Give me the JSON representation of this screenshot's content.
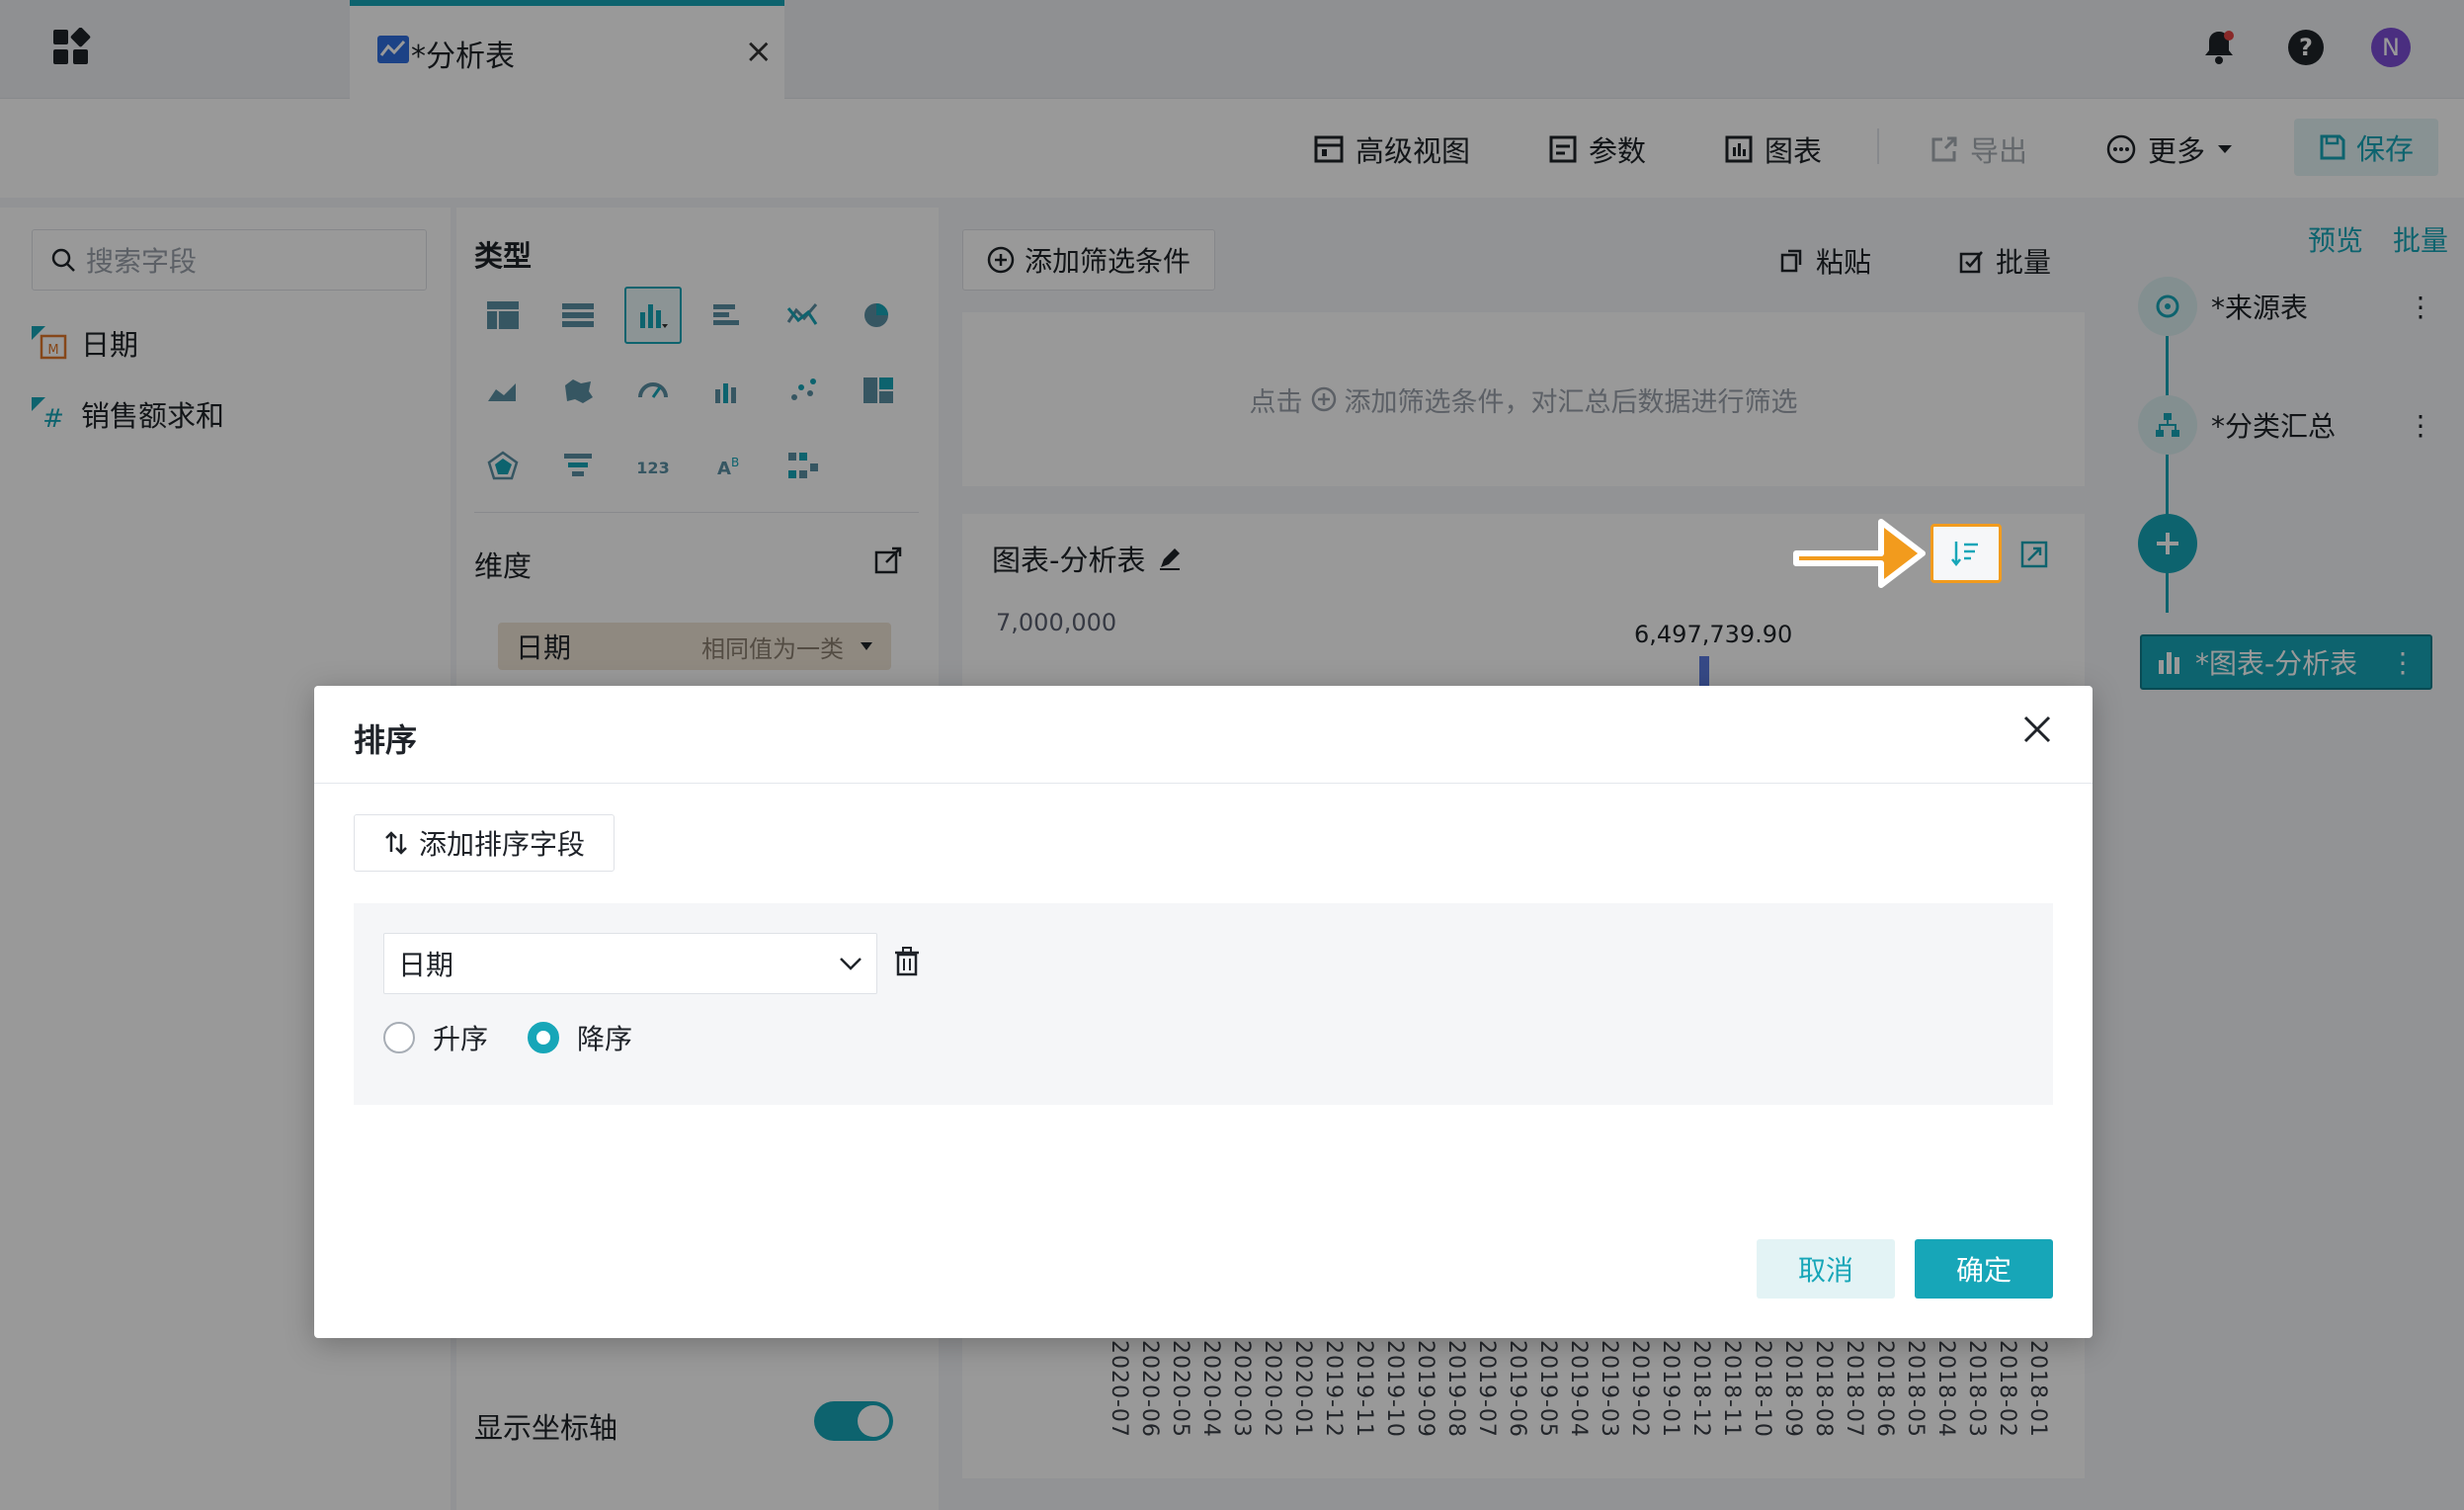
{
  "tab": {
    "title": "*分析表",
    "close": "×"
  },
  "header": {
    "avatar": "N"
  },
  "toolbar": {
    "advanced_view": "高级视图",
    "params": "参数",
    "chart": "图表",
    "export": "导出",
    "more": "更多",
    "save": "保存"
  },
  "fields": {
    "search_placeholder": "搜索字段",
    "items": [
      {
        "label": "日期",
        "type": "date"
      },
      {
        "label": "销售额求和",
        "type": "number"
      }
    ]
  },
  "config": {
    "type_title": "类型",
    "dimension_title": "维度",
    "dimension_chip": {
      "label": "日期",
      "mode": "相同值为一类"
    },
    "show_axis": "显示坐标轴"
  },
  "filter": {
    "add_button": "添加筛选条件",
    "paste": "粘贴",
    "batch": "批量",
    "hint_prefix": "点击",
    "hint_suffix": "添加筛选条件，对汇总后数据进行筛选"
  },
  "chart": {
    "title": "图表-分析表",
    "y_top_tick": "7,000,000",
    "max_label": "6,497,739.90",
    "x_labels": [
      "2020-07",
      "2020-06",
      "2020-05",
      "2020-04",
      "2020-03",
      "2020-02",
      "2020-01",
      "2019-12",
      "2019-11",
      "2019-10",
      "2019-09",
      "2019-08",
      "2019-07",
      "2019-06",
      "2019-05",
      "2019-04",
      "2019-03",
      "2019-02",
      "2019-01",
      "2018-12",
      "2018-11",
      "2018-10",
      "2018-09",
      "2018-08",
      "2018-07",
      "2018-06",
      "2018-05",
      "2018-04",
      "2018-03",
      "2018-02",
      "2018-01"
    ]
  },
  "right_panel": {
    "preview": "预览",
    "batch": "批量",
    "nodes": [
      "*来源表",
      "*分类汇总"
    ],
    "active_node": "*图表-分析表"
  },
  "dialog": {
    "title": "排序",
    "add_sort_field": "添加排序字段",
    "field_value": "日期",
    "asc_label": "升序",
    "desc_label": "降序",
    "selected": "desc",
    "cancel": "取消",
    "confirm": "确定"
  },
  "colors": {
    "accent": "#17a6b8",
    "highlight": "#f29b1d"
  }
}
